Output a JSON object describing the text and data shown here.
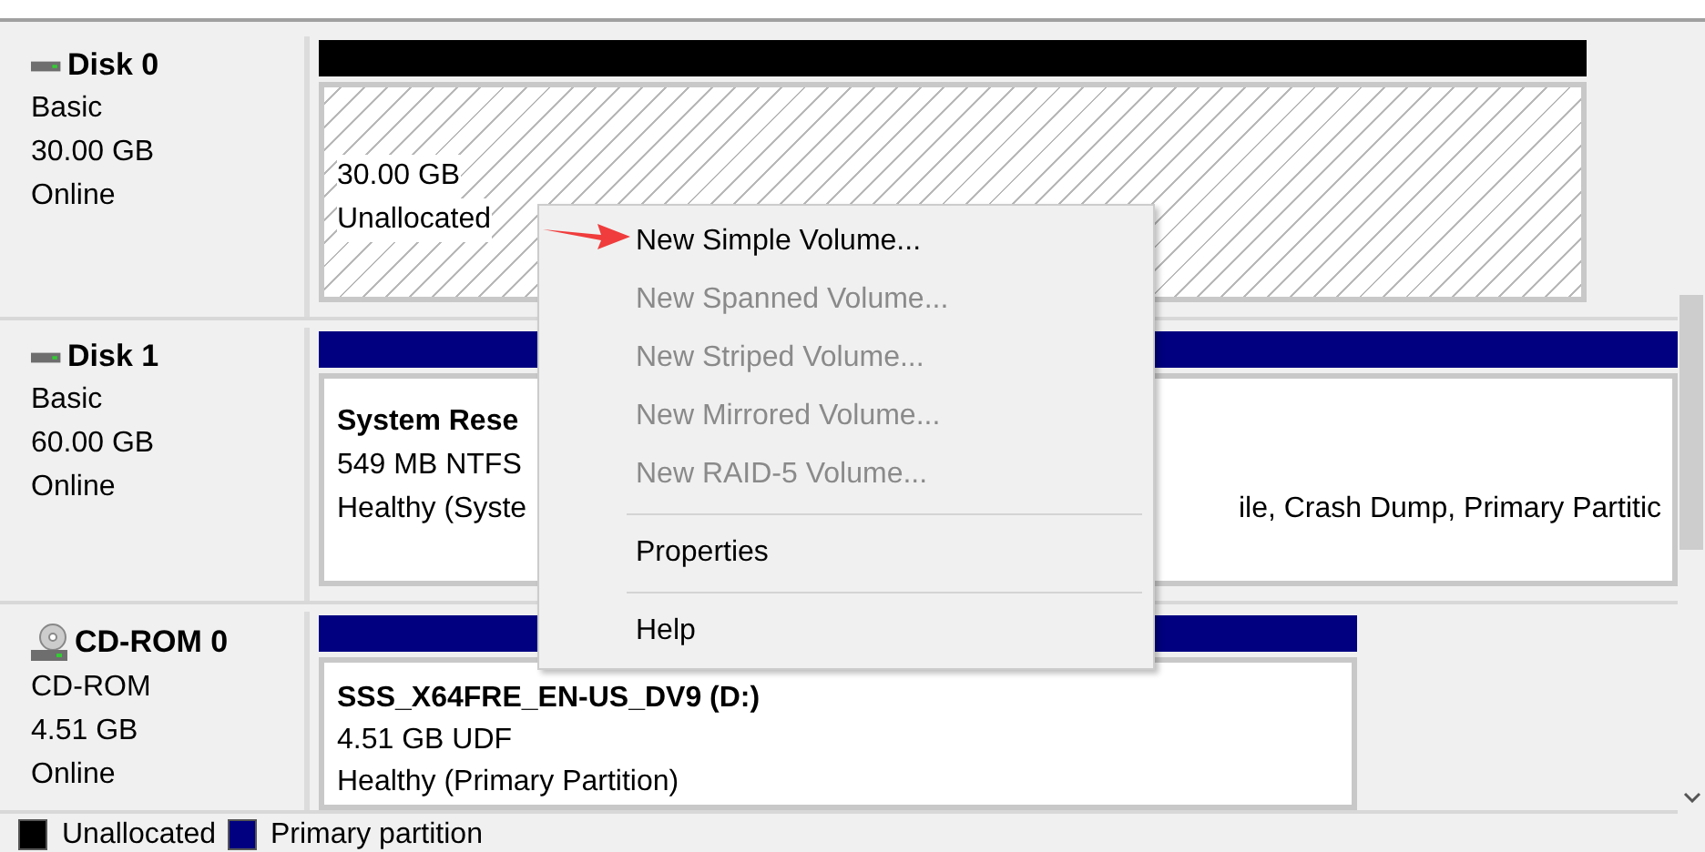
{
  "disks": [
    {
      "kind": "disk",
      "name": "Disk 0",
      "type": "Basic",
      "size": "30.00 GB",
      "status": "Online",
      "partition": {
        "kind": "unallocated",
        "color": "#000000",
        "lines": [
          "30.00 GB",
          "Unallocated"
        ]
      }
    },
    {
      "kind": "disk",
      "name": "Disk 1",
      "type": "Basic",
      "size": "60.00 GB",
      "status": "Online",
      "partition": {
        "kind": "primary",
        "color": "#000080",
        "name": "System Rese",
        "lines": [
          "549 MB NTFS"
        ],
        "status": "Healthy (Syste",
        "status_tail": "ile, Crash Dump, Primary Partitic"
      }
    },
    {
      "kind": "cdrom",
      "name": "CD-ROM 0",
      "type": "CD-ROM",
      "size": "4.51 GB",
      "status": "Online",
      "partition": {
        "kind": "primary",
        "color": "#000080",
        "name": "SSS_X64FRE_EN-US_DV9 (D:)",
        "lines": [
          "4.51 GB UDF",
          "Healthy (Primary Partition)"
        ]
      }
    }
  ],
  "context_menu": {
    "items": [
      {
        "kind": "item",
        "label": "New Simple Volume...",
        "disabled": false
      },
      {
        "kind": "item",
        "label": "New Spanned Volume...",
        "disabled": true
      },
      {
        "kind": "item",
        "label": "New Striped Volume...",
        "disabled": true
      },
      {
        "kind": "item",
        "label": "New Mirrored Volume...",
        "disabled": true
      },
      {
        "kind": "item",
        "label": "New RAID-5 Volume...",
        "disabled": true
      },
      {
        "kind": "separator"
      },
      {
        "kind": "item",
        "label": "Properties",
        "disabled": false
      },
      {
        "kind": "separator"
      },
      {
        "kind": "item",
        "label": "Help",
        "disabled": false
      }
    ]
  },
  "legend": [
    {
      "label": "Unallocated",
      "color": "#000000"
    },
    {
      "label": "Primary partition",
      "color": "#000080"
    }
  ]
}
